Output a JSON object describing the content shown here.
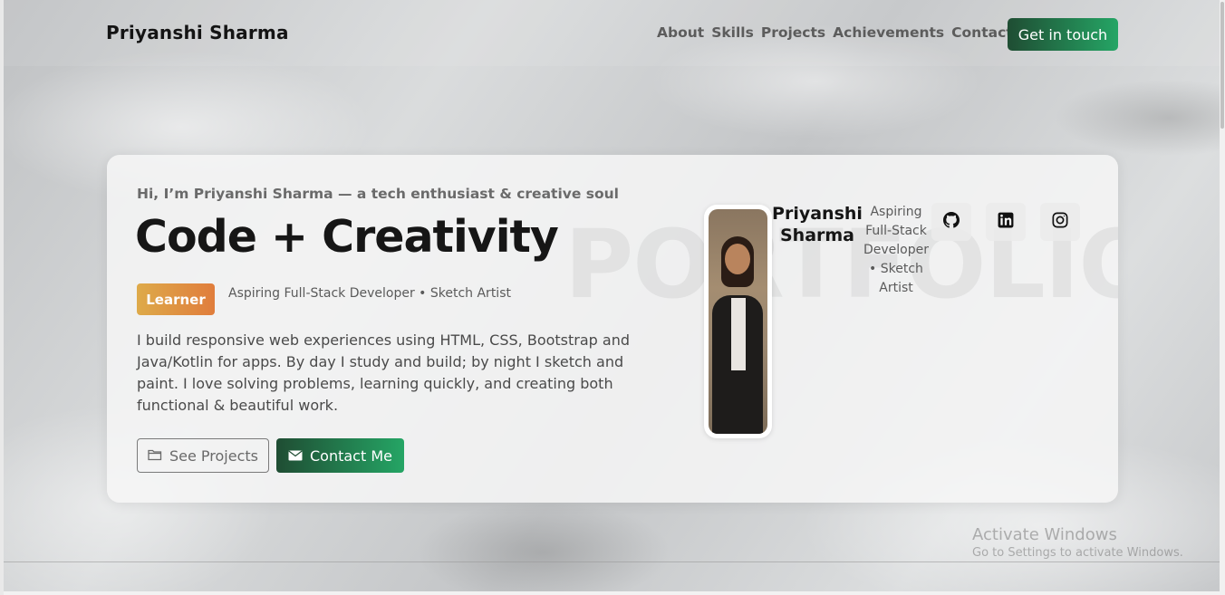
{
  "header": {
    "brand": "Priyanshi Sharma",
    "nav": [
      "About",
      "Skills",
      "Projects",
      "Achievements",
      "Contact"
    ],
    "cta": "Get in touch"
  },
  "hero": {
    "intro": "Hi, I’m Priyanshi Sharma — a tech enthusiast & creative soul",
    "headline": "Code + Creativity",
    "badge": "Learner",
    "role": "Aspiring Full-Stack Developer • Sketch Artist",
    "description": "I build responsive web experiences using HTML, CSS, Bootstrap and Java/Kotlin for apps. By day I study and build; by night I sketch and paint. I love solving problems, learning quickly, and creating both functional & beautiful work.",
    "buttons": {
      "projects": "See Projects",
      "contact": "Contact Me"
    },
    "watermark": "PORTFOLIO"
  },
  "profile": {
    "name": "Priyanshi Sharma",
    "role": "Aspiring Full-Stack Developer • Sketch Artist",
    "socials": [
      "github-icon",
      "linkedin-icon",
      "instagram-icon"
    ]
  },
  "os_overlay": {
    "title": "Activate Windows",
    "subtitle": "Go to Settings to activate Windows."
  },
  "colors": {
    "accent_start": "#1f4d33",
    "accent_end": "#25a565",
    "badge_start": "#deaa4a",
    "badge_end": "#e07d3c"
  }
}
